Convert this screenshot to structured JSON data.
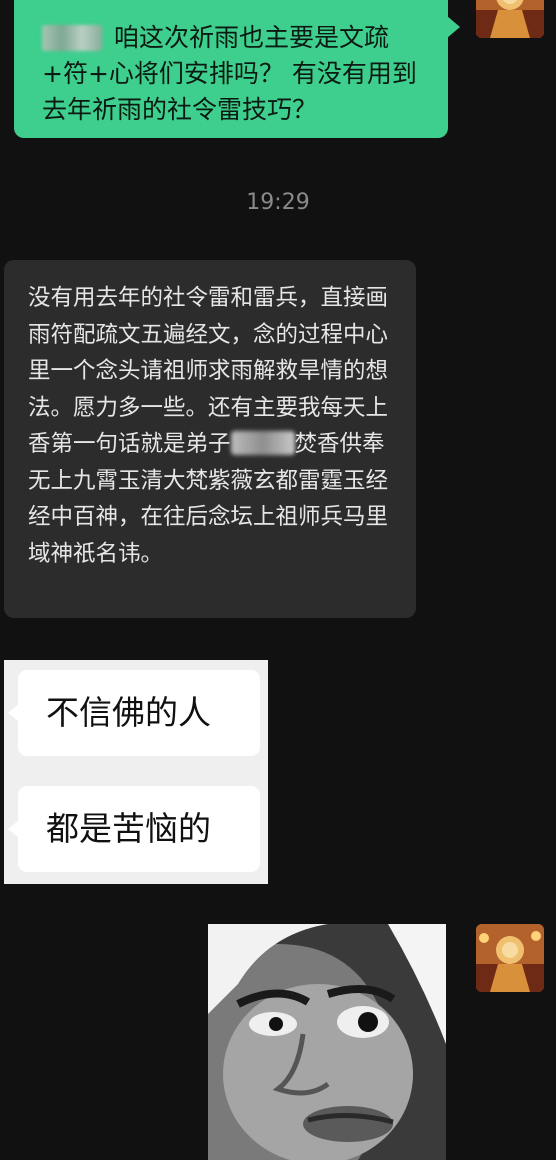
{
  "messages": {
    "outgoing_1": {
      "text": "咱这次祈雨也主要是文疏+符+心将们安排吗？ 有没有用到去年祈雨的社令雷技巧？"
    },
    "timestamp": "19:29",
    "incoming_1": {
      "text_before": "没有用去年的社令雷和雷兵，直接画雨符配疏文五遍经文，念的过程中心里一个念头请祖师求雨解救旱情的想法。愿力多一些。还有主要我每天上香第一句话就是弟子",
      "text_after": "焚香供奉无上九霄玉清大梵紫薇玄都雷霆玉经经中百神，在往后念坛上祖师兵马里域神祇名讳。"
    },
    "forwarded_image": {
      "line_1": "不信佛的人",
      "line_2": "都是苦恼的"
    }
  },
  "colors": {
    "background": "#111111",
    "outgoing_bubble": "#3ecf8e",
    "incoming_bubble": "#2c2c2c",
    "timestamp_text": "#8a8a8a"
  },
  "icons": {
    "avatar": "deity-statue-avatar",
    "sticker": "surprised-face-meme-sticker"
  }
}
